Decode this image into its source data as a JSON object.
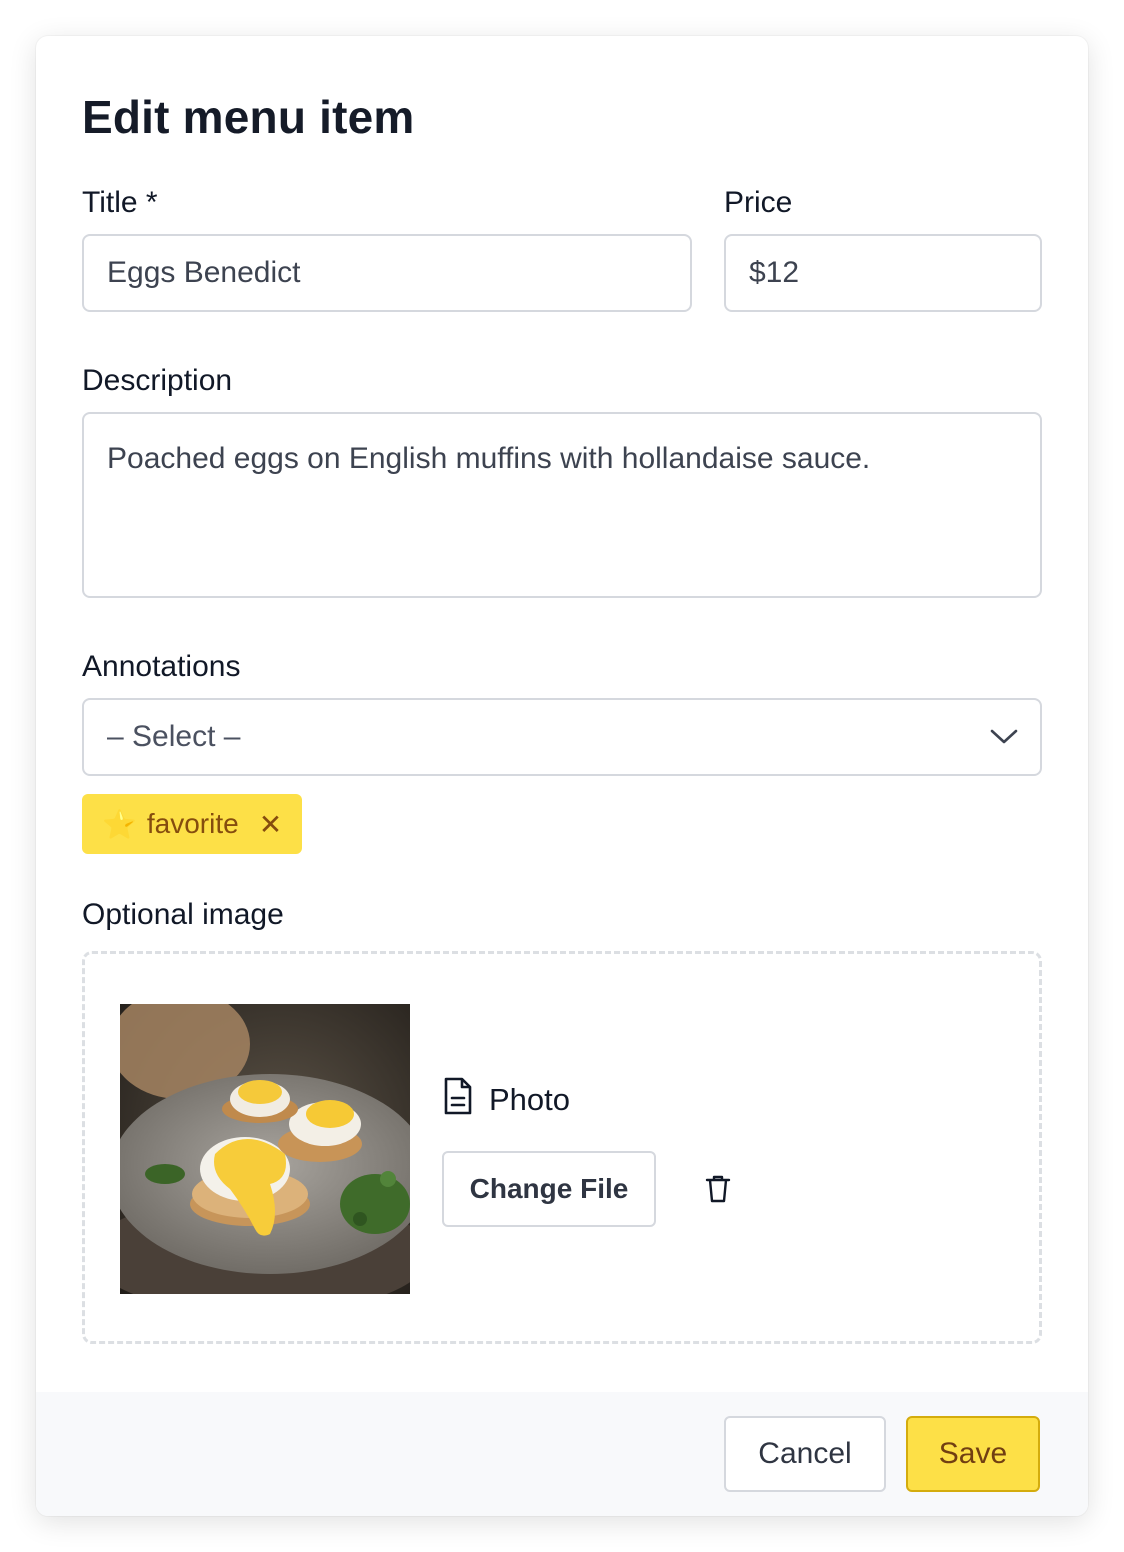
{
  "dialog": {
    "title": "Edit menu item"
  },
  "form": {
    "title_label": "Title *",
    "title_value": "Eggs Benedict",
    "price_label": "Price",
    "price_value": "$12",
    "description_label": "Description",
    "description_value": "Poached eggs on English muffins with hollandaise sauce.",
    "annotations_label": "Annotations",
    "annotations_placeholder": "– Select –",
    "annotations_selected": [
      {
        "emoji": "⭐",
        "label": "favorite",
        "remove_glyph": "✕"
      }
    ],
    "image_label": "Optional image",
    "image_file_label": "Photo",
    "change_file_label": "Change File"
  },
  "footer": {
    "cancel_label": "Cancel",
    "save_label": "Save"
  },
  "colors": {
    "accent": "#fde047",
    "accent_text": "#854d0e",
    "border": "#d5d8de"
  },
  "icons": {
    "select_chevron": "chevron-down-icon",
    "file": "file-icon",
    "delete": "trash-icon",
    "chip_remove": "close-icon"
  }
}
